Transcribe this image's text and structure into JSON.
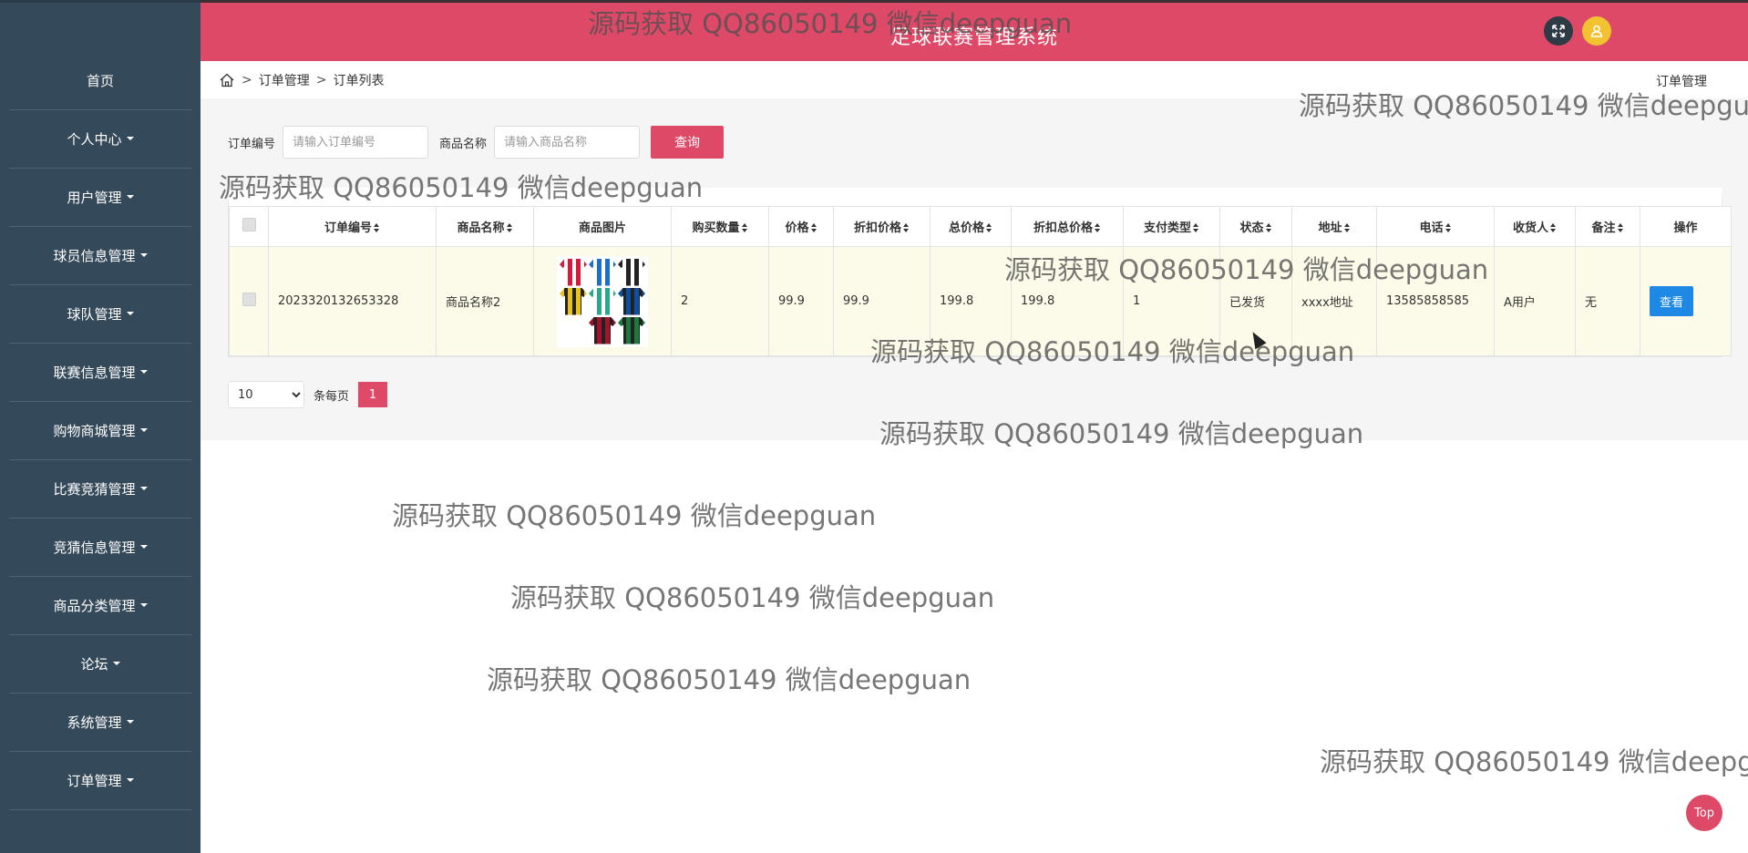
{
  "header": {
    "title": "足球联赛管理系统",
    "expand_icon": "expand-icon",
    "user_icon": "user-icon",
    "colors": {
      "primary": "#de4968",
      "sidebar": "#34495a",
      "view_button": "#1e88e5"
    }
  },
  "sidebar": {
    "items": [
      {
        "label": "首页",
        "has_caret": false
      },
      {
        "label": "个人中心",
        "has_caret": true
      },
      {
        "label": "用户管理",
        "has_caret": true
      },
      {
        "label": "球员信息管理",
        "has_caret": true
      },
      {
        "label": "球队管理",
        "has_caret": true
      },
      {
        "label": "联赛信息管理",
        "has_caret": true
      },
      {
        "label": "购物商城管理",
        "has_caret": true
      },
      {
        "label": "比赛竞猜管理",
        "has_caret": true
      },
      {
        "label": "竞猜信息管理",
        "has_caret": true
      },
      {
        "label": "商品分类管理",
        "has_caret": true
      },
      {
        "label": "论坛",
        "has_caret": true
      },
      {
        "label": "系统管理",
        "has_caret": true
      },
      {
        "label": "订单管理",
        "has_caret": true
      }
    ]
  },
  "breadcrumb": {
    "items": [
      "订单管理",
      "订单列表"
    ],
    "separator": ">",
    "right_title": "订单管理"
  },
  "search": {
    "order_no_label": "订单编号",
    "order_no_placeholder": "请输入订单编号",
    "product_label": "商品名称",
    "product_placeholder": "请输入商品名称",
    "query_button": "查询"
  },
  "table": {
    "columns": [
      "订单编号",
      "商品名称",
      "商品图片",
      "购买数量",
      "价格",
      "折扣价格",
      "总价格",
      "折扣总价格",
      "支付类型",
      "状态",
      "地址",
      "电话",
      "收货人",
      "备注",
      "操作"
    ],
    "rows": [
      {
        "order_no": "2023320132653328",
        "product_name": "商品名称2",
        "quantity": "2",
        "price": "99.9",
        "discount_price": "99.9",
        "total_price": "199.8",
        "discount_total": "199.8",
        "pay_type": "1",
        "status": "已发货",
        "address": "xxxx地址",
        "phone": "13585858585",
        "receiver": "A用户",
        "remark": "无",
        "action": "查看"
      }
    ]
  },
  "pagination": {
    "page_size": "10",
    "page_size_options": [
      "10"
    ],
    "per_page_label": "条每页",
    "current_page": "1"
  },
  "watermark": {
    "text": "源码获取 QQ86050149 微信deepguan",
    "text_cut": "源码获取 QQ86050149 微信deepgu",
    "text_cut2": "源码获取 QQ86050149 微信deepg"
  },
  "top_button": "Top"
}
